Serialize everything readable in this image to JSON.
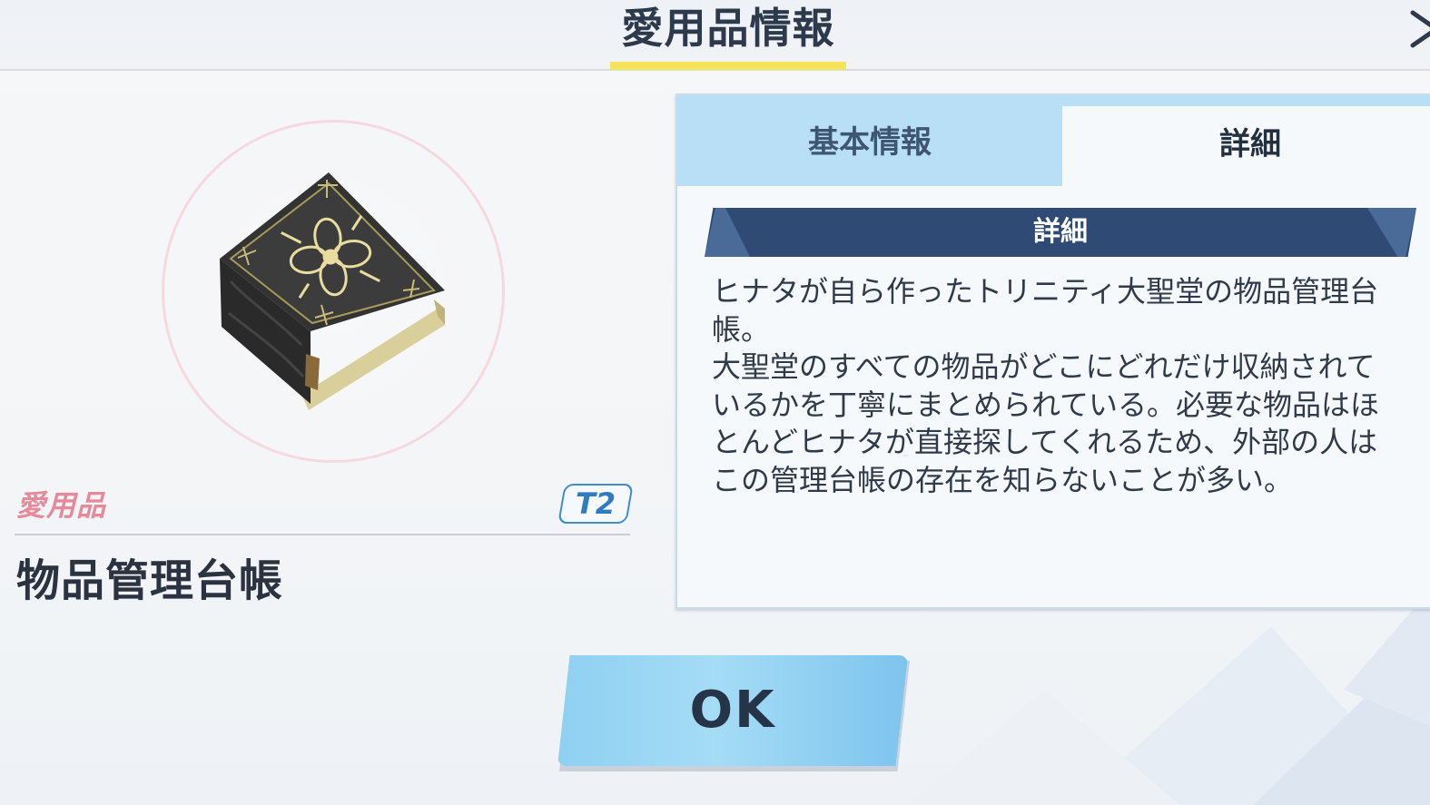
{
  "header": {
    "title": "愛用品情報",
    "close_icon": "close-icon"
  },
  "item": {
    "category": "愛用品",
    "tier": "T2",
    "name": "物品管理台帳",
    "image_icon": "book-icon"
  },
  "panel": {
    "tabs": [
      {
        "label": "基本情報",
        "active": false
      },
      {
        "label": "詳細",
        "active": true
      }
    ],
    "section_title": "詳細",
    "description": "ヒナタが自ら作ったトリニティ大聖堂の物品管理台\n帳。\n大聖堂のすべての物品がどこにどれだけ収納されて\nいるかを丁寧にまとめられている。必要な物品はほ\nとんどヒナタが直接探してくれるため、外部の人は\nこの管理台帳の存在を知らないことが多い。"
  },
  "actions": {
    "ok_label": "OK"
  },
  "colors": {
    "accent_yellow": "#f5e35a",
    "banner_navy": "#2f4a75",
    "tab_blue": "#b9dff6",
    "ok_blue": "#8fd0f2",
    "category_pink": "#e58a9a",
    "tier_blue": "#2f7cc0"
  }
}
